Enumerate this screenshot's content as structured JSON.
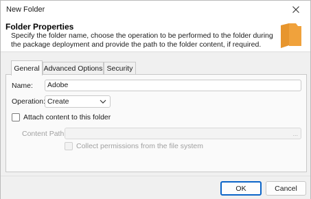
{
  "window": {
    "title": "New Folder"
  },
  "header": {
    "title": "Folder Properties",
    "description": "Specify the folder name, choose the operation to be performed to the folder during the package deployment and provide the path to the folder content, if required."
  },
  "tabs": [
    {
      "label": "General",
      "active": true
    },
    {
      "label": "Advanced Options",
      "active": false
    },
    {
      "label": "Security",
      "active": false
    }
  ],
  "general": {
    "name_label": "Name:",
    "name_value": "Adobe",
    "operation_label": "Operation:",
    "operation_value": "Create",
    "attach_label": "Attach content to this folder",
    "attach_checked": false,
    "content_path_label": "Content Path:",
    "content_path_value": "",
    "browse_label": "...",
    "collect_label": "Collect permissions from the file system",
    "collect_checked": false
  },
  "footer": {
    "ok_label": "OK",
    "cancel_label": "Cancel"
  },
  "colors": {
    "accent": "#0a64c8",
    "folder": "#f0a23c"
  },
  "icons": {
    "close": "close-icon",
    "folder": "folder-icon",
    "dropdown": "chevron-down-icon"
  }
}
